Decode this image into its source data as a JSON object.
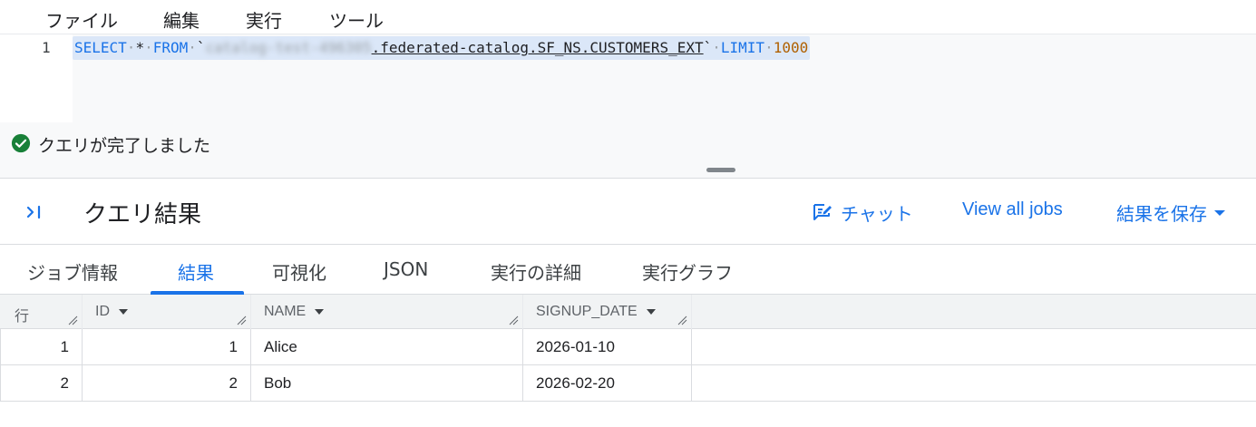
{
  "menu": {
    "file": "ファイル",
    "edit": "編集",
    "run": "実行",
    "tools": "ツール"
  },
  "editor": {
    "line_number": "1",
    "tokens": {
      "select": "SELECT",
      "star": "*",
      "from": "FROM",
      "backtick_open": "`",
      "redacted_project": "catalog-test-496305",
      "table_path": ".federated-catalog.SF_NS.CUSTOMERS_EXT",
      "backtick_close": "`",
      "limit": "LIMIT",
      "limit_value": "1000"
    }
  },
  "status": {
    "text": "クエリが完了しました",
    "icon": "check-circle-icon",
    "color": "#188038"
  },
  "results_header": {
    "title": "クエリ結果",
    "chat_label": "チャット",
    "view_jobs_label": "View all jobs",
    "save_label": "結果を保存"
  },
  "tabs": [
    {
      "label": "ジョブ情報"
    },
    {
      "label": "結果"
    },
    {
      "label": "可視化"
    },
    {
      "label": "JSON"
    },
    {
      "label": "実行の詳細"
    },
    {
      "label": "実行グラフ"
    }
  ],
  "active_tab": "結果",
  "table": {
    "columns": {
      "row": "行",
      "id": "ID",
      "name": "NAME",
      "signup_date": "SIGNUP_DATE"
    },
    "rows": [
      {
        "row": "1",
        "id": "1",
        "name": "Alice",
        "signup_date": "2026-01-10"
      },
      {
        "row": "2",
        "id": "2",
        "name": "Bob",
        "signup_date": "2026-02-20"
      }
    ]
  },
  "colors": {
    "accent": "#1a73e8",
    "success": "#188038"
  }
}
